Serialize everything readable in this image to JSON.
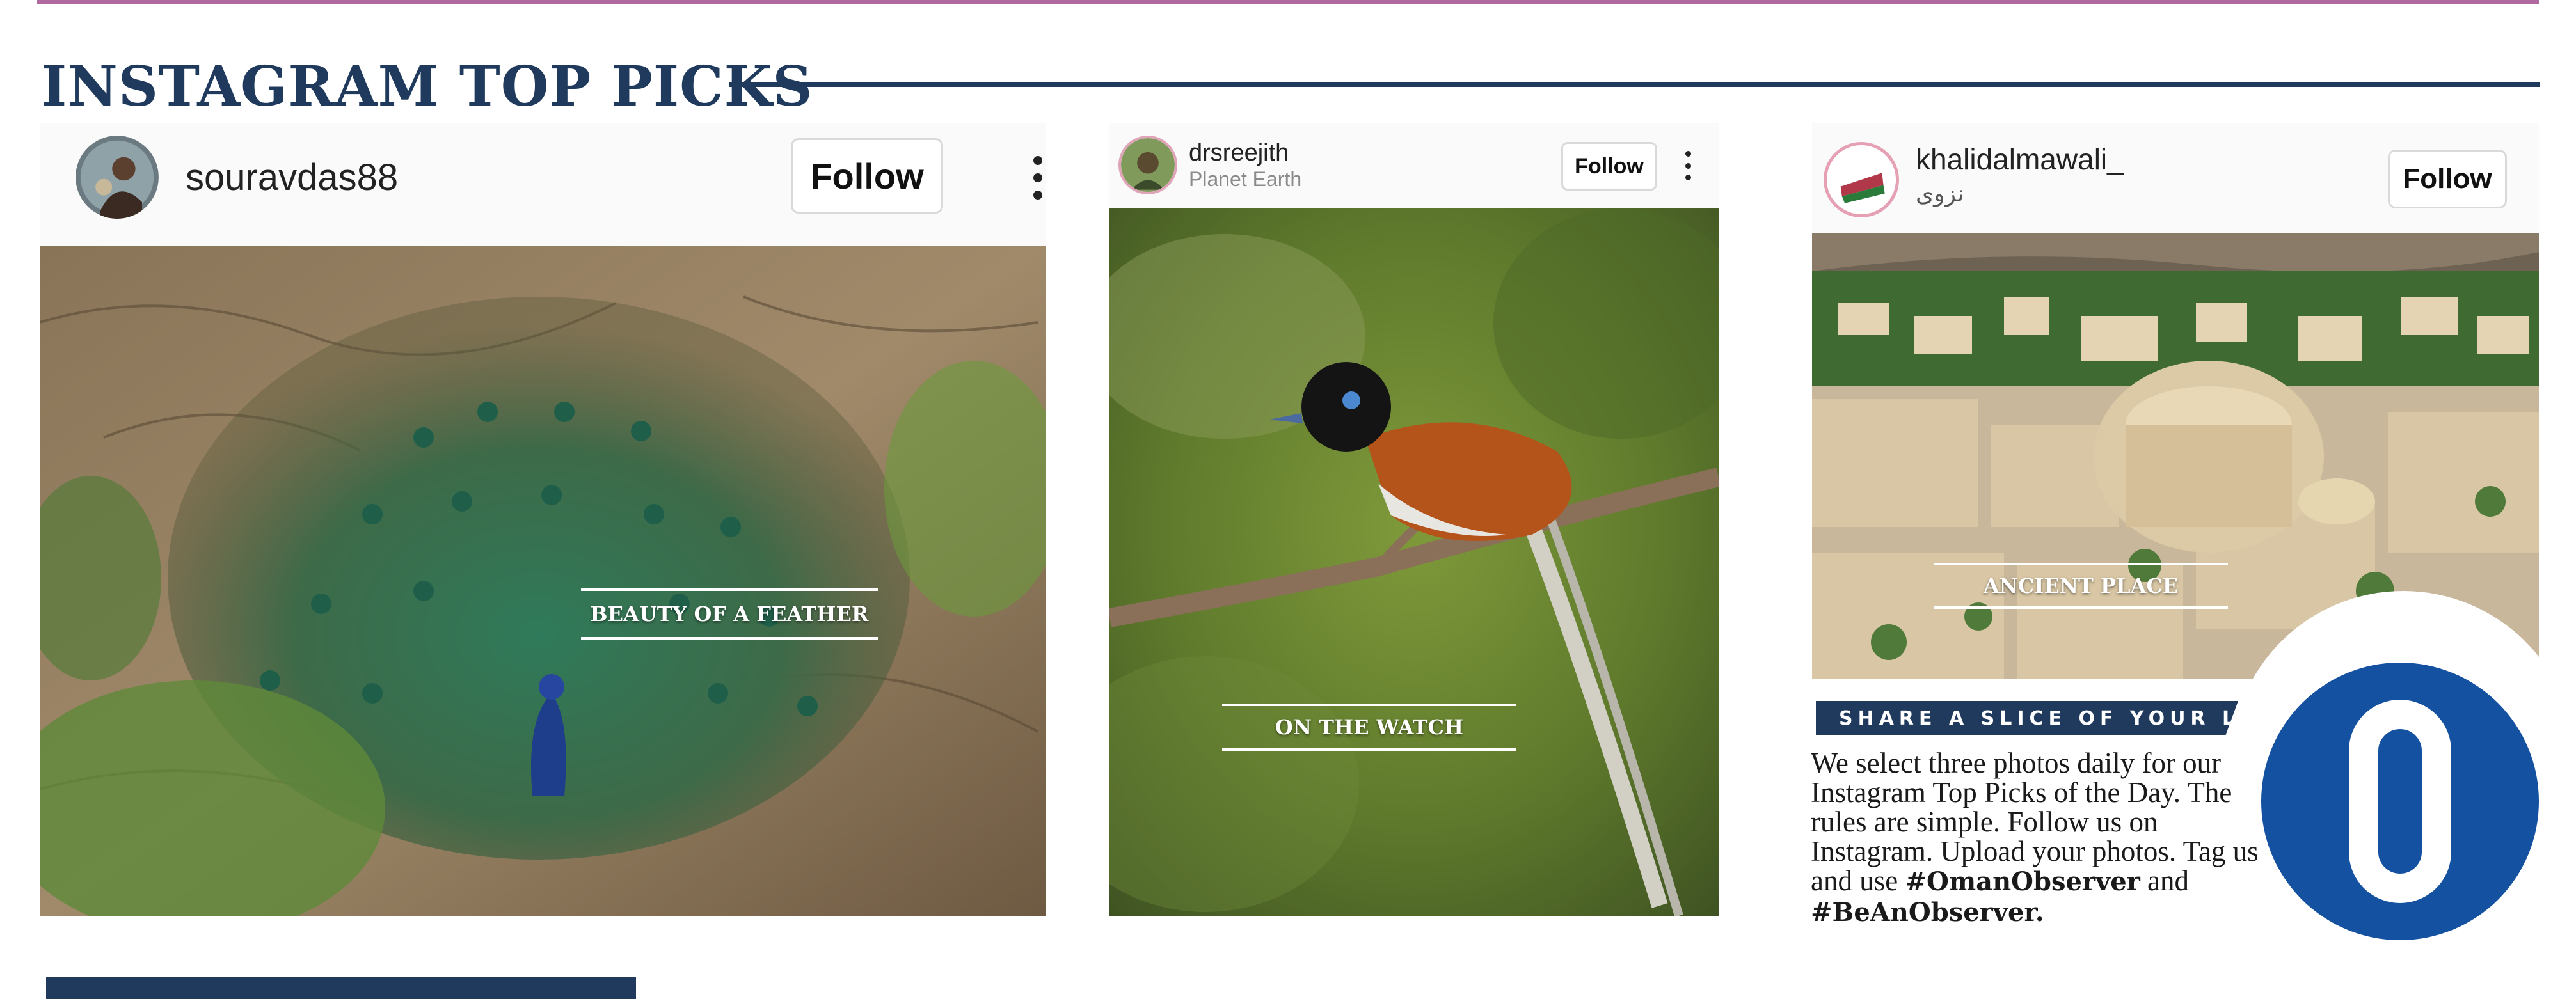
{
  "section": {
    "title": "INSTAGRAM TOP PICKS"
  },
  "posts": [
    {
      "username": "souravdas88",
      "subtitle": "",
      "follow_label": "Follow",
      "caption": "BEAUTY OF A FEATHER",
      "image_subject": "peacock"
    },
    {
      "username": "drsreejith",
      "subtitle": "Planet Earth",
      "follow_label": "Follow",
      "caption": "ON THE WATCH",
      "image_subject": "paradise flycatcher"
    },
    {
      "username": "khalidalmawali_",
      "subtitle": "نزوى",
      "follow_label": "Follow",
      "caption": "ANCIENT PLACE",
      "image_subject": "Nizwa fort aerial view"
    }
  ],
  "cta": {
    "banner": "SHARE A SLICE OF YOUR LIFE",
    "body_lead": "We select three photos daily for our Instagram Top Picks of the Day. The rules are simple. Follow us on Instagram. Upload your photos. Tag us and use",
    "hashtag_1": "#OmanObserver",
    "joiner": "and",
    "hashtag_2": "#BeAnObserver."
  },
  "colors": {
    "navy": "#1f3a5c",
    "logo_blue": "#1451a0",
    "accent_rule": "#b06aa0"
  },
  "icons": {
    "more": "more-vertical-icon",
    "logo": "oman-observer-logo"
  }
}
